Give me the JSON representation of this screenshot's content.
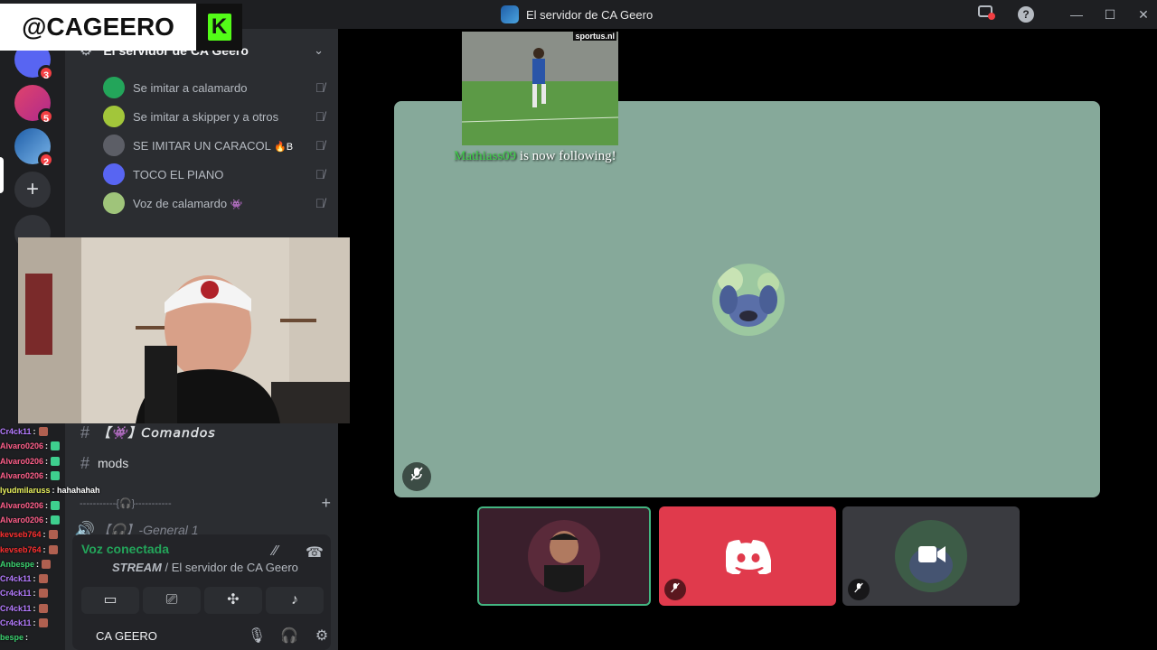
{
  "window": {
    "title": "El servidor de CA Geero",
    "controls": {
      "minimize": "—",
      "maximize": "☐",
      "close": "✕",
      "help": "?"
    }
  },
  "rail": {
    "badges": [
      "3",
      "5",
      "2"
    ],
    "add_server": "+"
  },
  "server": {
    "name": "El servidor de CA Geero",
    "chevron": "⌄"
  },
  "voice_users": [
    {
      "name": "Se imitar a calamardo",
      "suffix": "",
      "avatar_color": "#23a55a"
    },
    {
      "name": "Se imitar a skipper y a otros",
      "suffix": "",
      "avatar_color": "#a2c63a"
    },
    {
      "name": "SE IMITAR UN CARACOL",
      "suffix": "🔥B",
      "avatar_color": "#5c5e66"
    },
    {
      "name": "TOCO EL PIANO",
      "suffix": "",
      "avatar_color": "#5865f2"
    },
    {
      "name": "Voz de calamardo",
      "suffix": "👾",
      "avatar_color": "#9fc47a"
    }
  ],
  "channels": {
    "comandos": "【👾】𝘊𝘰𝘮𝘢𝘯𝘥𝘰𝘴",
    "mods": "mods",
    "category": "-----------{🎧}-----------",
    "general": "【🎧】-General 1"
  },
  "voice_panel": {
    "status": "Voz conectada",
    "stream_label": "STREAM",
    "server_path": "/ El servidor de CA Geero"
  },
  "user": {
    "name": "CA GEERO"
  },
  "brand": {
    "handle": "@CAGEERO",
    "logo_letter": "K",
    "logo_color": "#53fc18"
  },
  "chat": [
    {
      "user": "Cr4ck11",
      "msg": ":",
      "color": "#b57bff",
      "emote": true
    },
    {
      "user": "Alvaro0206",
      "msg": ":",
      "color": "#ff5f8a",
      "emote": true
    },
    {
      "user": "Alvaro0206",
      "msg": ":",
      "color": "#ff5f8a",
      "emote": true
    },
    {
      "user": "Alvaro0206",
      "msg": ":",
      "color": "#ff5f8a",
      "emote": true
    },
    {
      "user": "lyudmilaruss",
      "msg": ": hahahahah",
      "color": "#e8f05c",
      "emote": false
    },
    {
      "user": "Alvaro0206",
      "msg": ":",
      "color": "#ff5f8a",
      "emote": true
    },
    {
      "user": "Alvaro0206",
      "msg": ":",
      "color": "#ff5f8a",
      "emote": true
    },
    {
      "user": "kevseb764",
      "msg": ":",
      "color": "#ff3030",
      "emote": true
    },
    {
      "user": "kevseb764",
      "msg": ":",
      "color": "#ff3030",
      "emote": true
    },
    {
      "user": "Anbespe",
      "msg": ":",
      "color": "#3bd16f",
      "emote": true
    },
    {
      "user": "Cr4ck11",
      "msg": ":",
      "color": "#b57bff",
      "emote": true
    },
    {
      "user": "Cr4ck11",
      "msg": ":",
      "color": "#b57bff",
      "emote": true
    },
    {
      "user": "Cr4ck11",
      "msg": ":",
      "color": "#b57bff",
      "emote": true
    },
    {
      "user": "Cr4ck11",
      "msg": ":",
      "color": "#b57bff",
      "emote": true
    },
    {
      "user": "bespe",
      "msg": ":",
      "color": "#3bd16f",
      "emote": false
    }
  ],
  "stage": {
    "follow_alert": {
      "name": "Mathiass09",
      "text": "is now following!",
      "clip_watermark": "sportus.nl"
    },
    "main_tile_color": "#86a99a",
    "tiles": [
      {
        "id": "streamer",
        "color": "#3a1f2c",
        "speaking": true
      },
      {
        "id": "discord",
        "color": "#e03a4c"
      },
      {
        "id": "camera",
        "color": "#3a3b40"
      }
    ]
  }
}
